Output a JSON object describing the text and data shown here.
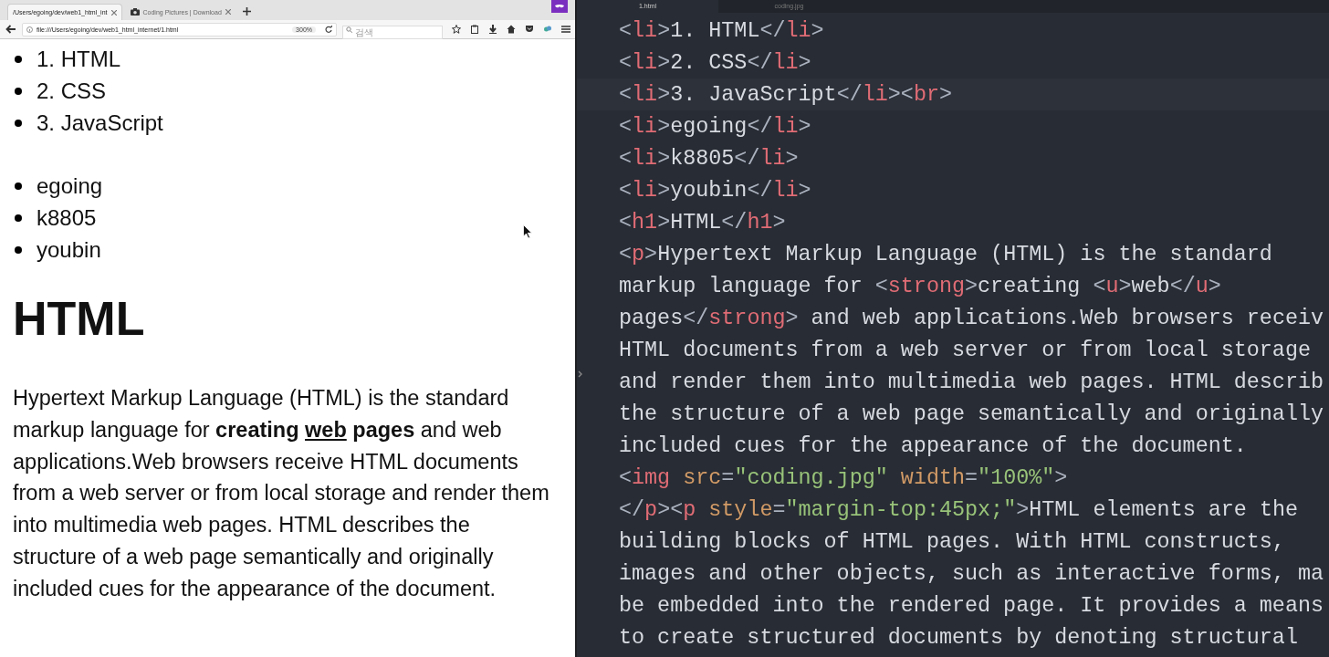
{
  "browser": {
    "tabs": [
      {
        "label": "/Users/egoing/dev/web1_html_int",
        "selected": true,
        "icon": false
      },
      {
        "label": "Coding Pictures | Download",
        "selected": false,
        "icon": true
      }
    ],
    "url": "file:///Users/egoing/dev/web1_html_internet/1.html",
    "zoom": "300%",
    "search": {
      "placeholder": "검색"
    }
  },
  "page": {
    "lists": [
      [
        "1. HTML",
        "2. CSS",
        "3. JavaScript"
      ],
      [
        "egoing",
        "k8805",
        "youbin"
      ]
    ],
    "heading": "HTML",
    "paragraph": [
      {
        "text": "Hypertext Markup Language (HTML) is the standard markup language for ",
        "bold": false,
        "underline": false
      },
      {
        "text": "creating ",
        "bold": true,
        "underline": false
      },
      {
        "text": "web",
        "bold": true,
        "underline": true
      },
      {
        "text": " pages",
        "bold": true,
        "underline": false
      },
      {
        "text": " and web applications.Web browsers receive HTML documents from a web server or from local storage and render them into multimedia web pages. HTML describes the structure of a web page semantically and originally included cues for the appearance of the document.",
        "bold": false,
        "underline": false
      }
    ]
  },
  "editor": {
    "tabs": [
      {
        "label": "1.html",
        "selected": true
      },
      {
        "label": "coding.jpg",
        "selected": false
      }
    ],
    "lines": [
      {
        "current": false,
        "tokens": [
          {
            "kind": "punct",
            "text": "<"
          },
          {
            "kind": "tag",
            "text": "li"
          },
          {
            "kind": "punct",
            "text": ">"
          },
          {
            "kind": "text",
            "text": "1. HTML"
          },
          {
            "kind": "punct",
            "text": "</"
          },
          {
            "kind": "tag",
            "text": "li"
          },
          {
            "kind": "punct",
            "text": ">"
          }
        ]
      },
      {
        "current": false,
        "tokens": [
          {
            "kind": "punct",
            "text": "<"
          },
          {
            "kind": "tag",
            "text": "li"
          },
          {
            "kind": "punct",
            "text": ">"
          },
          {
            "kind": "text",
            "text": "2. CSS"
          },
          {
            "kind": "punct",
            "text": "</"
          },
          {
            "kind": "tag",
            "text": "li"
          },
          {
            "kind": "punct",
            "text": ">"
          }
        ]
      },
      {
        "current": true,
        "tokens": [
          {
            "kind": "punct",
            "text": "<"
          },
          {
            "kind": "tag",
            "text": "li"
          },
          {
            "kind": "punct",
            "text": ">"
          },
          {
            "kind": "text",
            "text": "3. JavaScript"
          },
          {
            "kind": "punct",
            "text": "</"
          },
          {
            "kind": "tag",
            "text": "li"
          },
          {
            "kind": "punct",
            "text": "><"
          },
          {
            "kind": "tag",
            "text": "br"
          },
          {
            "kind": "punct",
            "text": ">"
          }
        ]
      },
      {
        "current": false,
        "tokens": [
          {
            "kind": "punct",
            "text": "<"
          },
          {
            "kind": "tag",
            "text": "li"
          },
          {
            "kind": "punct",
            "text": ">"
          },
          {
            "kind": "text",
            "text": "egoing"
          },
          {
            "kind": "punct",
            "text": "</"
          },
          {
            "kind": "tag",
            "text": "li"
          },
          {
            "kind": "punct",
            "text": ">"
          }
        ]
      },
      {
        "current": false,
        "tokens": [
          {
            "kind": "punct",
            "text": "<"
          },
          {
            "kind": "tag",
            "text": "li"
          },
          {
            "kind": "punct",
            "text": ">"
          },
          {
            "kind": "text",
            "text": "k8805"
          },
          {
            "kind": "punct",
            "text": "</"
          },
          {
            "kind": "tag",
            "text": "li"
          },
          {
            "kind": "punct",
            "text": ">"
          }
        ]
      },
      {
        "current": false,
        "tokens": [
          {
            "kind": "punct",
            "text": "<"
          },
          {
            "kind": "tag",
            "text": "li"
          },
          {
            "kind": "punct",
            "text": ">"
          },
          {
            "kind": "text",
            "text": "youbin"
          },
          {
            "kind": "punct",
            "text": "</"
          },
          {
            "kind": "tag",
            "text": "li"
          },
          {
            "kind": "punct",
            "text": ">"
          }
        ]
      },
      {
        "current": false,
        "tokens": [
          {
            "kind": "punct",
            "text": "<"
          },
          {
            "kind": "tag",
            "text": "h1"
          },
          {
            "kind": "punct",
            "text": ">"
          },
          {
            "kind": "text",
            "text": "HTML"
          },
          {
            "kind": "punct",
            "text": "</"
          },
          {
            "kind": "tag",
            "text": "h1"
          },
          {
            "kind": "punct",
            "text": ">"
          }
        ]
      },
      {
        "current": false,
        "tokens": [
          {
            "kind": "punct",
            "text": "<"
          },
          {
            "kind": "tag",
            "text": "p"
          },
          {
            "kind": "punct",
            "text": ">"
          },
          {
            "kind": "text",
            "text": "Hypertext Markup Language (HTML) is the standard"
          }
        ]
      },
      {
        "current": false,
        "tokens": [
          {
            "kind": "text",
            "text": "markup language for "
          },
          {
            "kind": "punct",
            "text": "<"
          },
          {
            "kind": "tag",
            "text": "strong"
          },
          {
            "kind": "punct",
            "text": ">"
          },
          {
            "kind": "text",
            "text": "creating "
          },
          {
            "kind": "punct",
            "text": "<"
          },
          {
            "kind": "tag",
            "text": "u"
          },
          {
            "kind": "punct",
            "text": ">"
          },
          {
            "kind": "text",
            "text": "web"
          },
          {
            "kind": "punct",
            "text": "</"
          },
          {
            "kind": "tag",
            "text": "u"
          },
          {
            "kind": "punct",
            "text": ">"
          }
        ]
      },
      {
        "current": false,
        "tokens": [
          {
            "kind": "text",
            "text": "pages"
          },
          {
            "kind": "punct",
            "text": "</"
          },
          {
            "kind": "tag",
            "text": "strong"
          },
          {
            "kind": "punct",
            "text": ">"
          },
          {
            "kind": "text",
            "text": " and web applications.Web browsers receiv"
          }
        ]
      },
      {
        "current": false,
        "tokens": [
          {
            "kind": "text",
            "text": "HTML documents from a web server or from local storage"
          }
        ]
      },
      {
        "current": false,
        "tokens": [
          {
            "kind": "text",
            "text": "and render them into multimedia web pages. HTML describ"
          }
        ]
      },
      {
        "current": false,
        "tokens": [
          {
            "kind": "text",
            "text": "the structure of a web page semantically and originally"
          }
        ]
      },
      {
        "current": false,
        "tokens": [
          {
            "kind": "text",
            "text": "included cues for the appearance of the document."
          }
        ]
      },
      {
        "current": false,
        "tokens": [
          {
            "kind": "punct",
            "text": "<"
          },
          {
            "kind": "tag",
            "text": "img"
          },
          {
            "kind": "attr",
            "text": " src"
          },
          {
            "kind": "punct",
            "text": "="
          },
          {
            "kind": "string",
            "text": "\"coding.jpg\""
          },
          {
            "kind": "attr",
            "text": " width"
          },
          {
            "kind": "punct",
            "text": "="
          },
          {
            "kind": "string",
            "text": "\"100%\""
          },
          {
            "kind": "punct",
            "text": ">"
          }
        ]
      },
      {
        "current": false,
        "tokens": [
          {
            "kind": "punct",
            "text": "</"
          },
          {
            "kind": "tag",
            "text": "p"
          },
          {
            "kind": "punct",
            "text": "><"
          },
          {
            "kind": "tag",
            "text": "p"
          },
          {
            "kind": "attr",
            "text": " style"
          },
          {
            "kind": "punct",
            "text": "="
          },
          {
            "kind": "string",
            "text": "\"margin-top:45px;\""
          },
          {
            "kind": "punct",
            "text": ">"
          },
          {
            "kind": "text",
            "text": "HTML elements are the"
          }
        ]
      },
      {
        "current": false,
        "tokens": [
          {
            "kind": "text",
            "text": "building blocks of HTML pages. With HTML constructs,"
          }
        ]
      },
      {
        "current": false,
        "tokens": [
          {
            "kind": "text",
            "text": "images and other objects, such as interactive forms, ma"
          }
        ]
      },
      {
        "current": false,
        "tokens": [
          {
            "kind": "text",
            "text": "be embedded into the rendered page. It provides a means"
          }
        ]
      },
      {
        "current": false,
        "tokens": [
          {
            "kind": "text",
            "text": "to create structured documents by denoting structural"
          }
        ]
      }
    ]
  }
}
